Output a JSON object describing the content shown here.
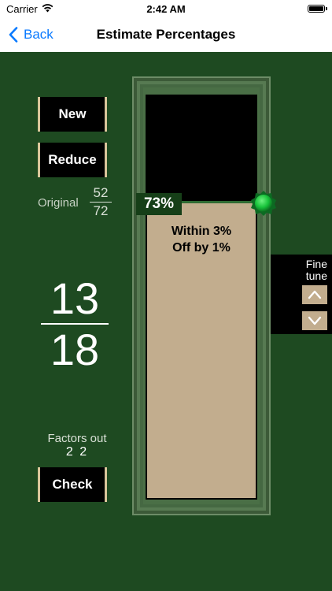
{
  "status": {
    "carrier": "Carrier",
    "time": "2:42 AM"
  },
  "navbar": {
    "back_label": "Back",
    "title": "Estimate Percentages"
  },
  "buttons": {
    "new_label": "New",
    "reduce_label": "Reduce",
    "check_label": "Check"
  },
  "original": {
    "label": "Original",
    "numerator": "52",
    "denominator": "72"
  },
  "fraction": {
    "numerator": "13",
    "denominator": "18"
  },
  "factors": {
    "label": "Factors out",
    "values": "2 2"
  },
  "gauge": {
    "percent_label": "73%",
    "percent_value": 73,
    "feedback_line1": "Within 3%",
    "feedback_line2": "Off by 1%"
  },
  "fine_tune": {
    "label_line1": "Fine",
    "label_line2": "tune"
  },
  "colors": {
    "background": "#1e4a21",
    "accent_tan": "#c2ad8e",
    "link_blue": "#0a7aff",
    "knob_green": "#17c23a"
  }
}
